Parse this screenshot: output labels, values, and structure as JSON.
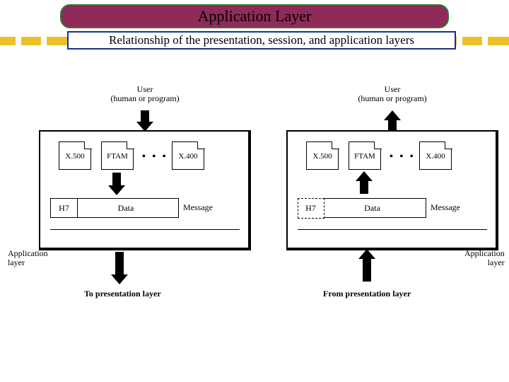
{
  "title": "Application Layer",
  "subtitle": "Relationship of the presentation, session, and application layers",
  "user_label_1": "User",
  "user_label_2": "(human or program)",
  "protocols": {
    "p1": "X.500",
    "p2": "FTAM",
    "p3": "X.400",
    "dots": "• • •"
  },
  "packet": {
    "header": "H7",
    "body": "Data",
    "label": "Message"
  },
  "side_label_1": "Application",
  "side_label_2": "layer",
  "bottom_left": "To presentation layer",
  "bottom_right": "From presentation layer"
}
